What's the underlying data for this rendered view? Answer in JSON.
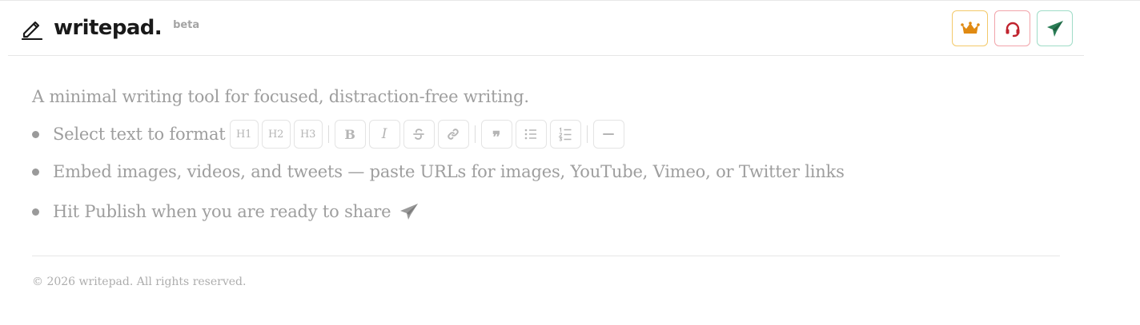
{
  "header": {
    "brand_name": "writepad.",
    "beta_label": "beta",
    "actions": [
      {
        "name": "premium-button",
        "icon": "crown-icon",
        "color": "#e08a12"
      },
      {
        "name": "support-button",
        "icon": "headset-icon",
        "color": "#c0232e"
      },
      {
        "name": "publish-button",
        "icon": "paper-plane-icon",
        "color": "#2a7d56"
      }
    ]
  },
  "main": {
    "intro": "A minimal writing tool for focused, distraction-free writing.",
    "bullets": [
      "Select text to format",
      "Embed images, videos, and tweets — paste URLs for images, YouTube, Vimeo, or Twitter links",
      "Hit Publish when you are ready to share"
    ],
    "format_toolbar": {
      "h1": "H1",
      "h2": "H2",
      "h3": "H3",
      "bold": "B",
      "italic": "I",
      "quote": "❞",
      "divider": "—"
    }
  },
  "footer": {
    "copyright": "© 2026 writepad. All rights reserved."
  }
}
